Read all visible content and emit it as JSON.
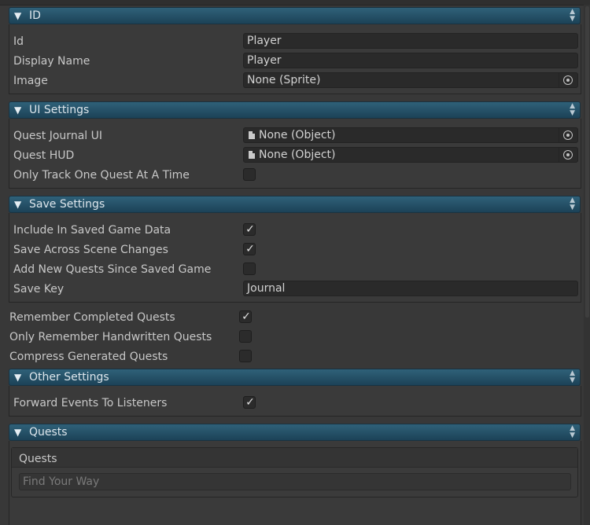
{
  "sections": {
    "id": {
      "title": "ID",
      "id_label": "Id",
      "id_value": "Player",
      "display_name_label": "Display Name",
      "display_name_value": "Player",
      "image_label": "Image",
      "image_value": "None (Sprite)"
    },
    "ui_settings": {
      "title": "UI Settings",
      "journal_label": "Quest Journal UI",
      "journal_value": "None (Object)",
      "hud_label": "Quest HUD",
      "hud_value": "None (Object)",
      "track_one_label": "Only Track One Quest At A Time",
      "track_one_checked": false
    },
    "save_settings": {
      "title": "Save Settings",
      "include_label": "Include In Saved Game Data",
      "include_checked": true,
      "across_label": "Save Across Scene Changes",
      "across_checked": true,
      "add_new_label": "Add New Quests Since Saved Game",
      "add_new_checked": false,
      "save_key_label": "Save Key",
      "save_key_value": "Journal"
    },
    "loose": {
      "remember_label": "Remember Completed Quests",
      "remember_checked": true,
      "handwritten_label": "Only Remember Handwritten Quests",
      "handwritten_checked": false,
      "compress_label": "Compress Generated Quests",
      "compress_checked": false
    },
    "other_settings": {
      "title": "Other Settings",
      "forward_label": "Forward Events To Listeners",
      "forward_checked": true
    },
    "quests": {
      "title": "Quests",
      "list_header": "Quests",
      "search_placeholder": "Find Your Way"
    }
  },
  "glyphs": {
    "foldout": "▼",
    "check": "✓",
    "sort_up": "▲",
    "sort_down": "▼"
  },
  "icons": {
    "object_picker": "object-picker-icon",
    "document": "document-icon",
    "foldout": "foldout-triangle-icon",
    "sort": "sort-arrows-icon"
  }
}
